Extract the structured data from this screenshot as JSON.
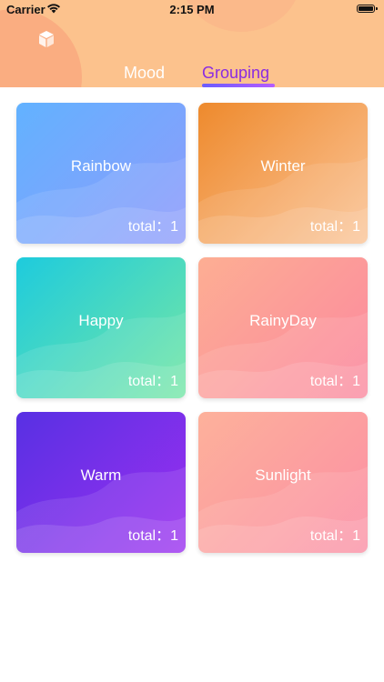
{
  "status_bar": {
    "carrier": "Carrier",
    "time": "2:15 PM",
    "icons": [
      "wifi-icon",
      "battery-icon"
    ]
  },
  "header": {
    "logo_icon": "cube-icon",
    "tabs": [
      {
        "label": "Mood",
        "selected": false
      },
      {
        "label": "Grouping",
        "selected": true
      }
    ],
    "accent_color": "#8a2be2"
  },
  "groups": [
    {
      "name": "Rainbow",
      "total": "total：1",
      "gradient": [
        "#62b2ff",
        "#8f9bfb"
      ]
    },
    {
      "name": "Winter",
      "total": "total：1",
      "gradient": [
        "#ee8a2d",
        "#fbc497"
      ]
    },
    {
      "name": "Happy",
      "total": "total：1",
      "gradient": [
        "#1ecbdd",
        "#74e6a5"
      ]
    },
    {
      "name": "RainyDay",
      "total": "total：1",
      "gradient": [
        "#fdae93",
        "#fb889f"
      ]
    },
    {
      "name": "Warm",
      "total": "total：1",
      "gradient": [
        "#5830e3",
        "#9b2ff0"
      ]
    },
    {
      "name": "Sunlight",
      "total": "total：1",
      "gradient": [
        "#fdb19b",
        "#fb8ea4"
      ]
    }
  ]
}
